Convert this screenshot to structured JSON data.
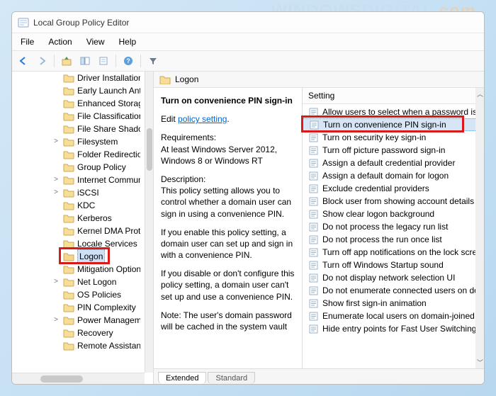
{
  "watermark": "WINDOWSDIGITAL",
  "watermark_suffix": ".com",
  "window": {
    "title": "Local Group Policy Editor"
  },
  "menu": {
    "file": "File",
    "action": "Action",
    "view": "View",
    "help": "Help"
  },
  "tree": {
    "items": [
      {
        "label": "Driver Installation",
        "exp": ""
      },
      {
        "label": "Early Launch Antimalware",
        "exp": ""
      },
      {
        "label": "Enhanced Storage",
        "exp": ""
      },
      {
        "label": "File Classification",
        "exp": ""
      },
      {
        "label": "File Share Shadow Copy",
        "exp": ""
      },
      {
        "label": "Filesystem",
        "exp": ">"
      },
      {
        "label": "Folder Redirection",
        "exp": ""
      },
      {
        "label": "Group Policy",
        "exp": ""
      },
      {
        "label": "Internet Communication",
        "exp": ">"
      },
      {
        "label": "iSCSI",
        "exp": ">"
      },
      {
        "label": "KDC",
        "exp": ""
      },
      {
        "label": "Kerberos",
        "exp": ""
      },
      {
        "label": "Kernel DMA Protection",
        "exp": ""
      },
      {
        "label": "Locale Services",
        "exp": ""
      },
      {
        "label": "Logon",
        "exp": "",
        "selected": true
      },
      {
        "label": "Mitigation Options",
        "exp": ""
      },
      {
        "label": "Net Logon",
        "exp": ">"
      },
      {
        "label": "OS Policies",
        "exp": ""
      },
      {
        "label": "PIN Complexity",
        "exp": ""
      },
      {
        "label": "Power Management",
        "exp": ">"
      },
      {
        "label": "Recovery",
        "exp": ""
      },
      {
        "label": "Remote Assistance",
        "exp": ""
      }
    ]
  },
  "breadcrumb": {
    "label": "Logon"
  },
  "description": {
    "topic": "Turn on convenience PIN sign-in",
    "edit_prefix": "Edit ",
    "edit_link": "policy setting",
    "req_head": "Requirements:",
    "req_body": "At least Windows Server 2012, Windows 8 or Windows RT",
    "desc_head": "Description:",
    "desc_body": "This policy setting allows you to control whether a domain user can sign in using a convenience PIN.",
    "enable_body": "If you enable this policy setting, a domain user can set up and sign in with a convenience PIN.",
    "disable_body": "If you disable or don't configure this policy setting, a domain user can't set up and use a convenience PIN.",
    "note_body": "Note: The user's domain password will be cached in the system vault"
  },
  "settings": {
    "header": "Setting",
    "items": [
      {
        "label": "Allow users to select when a password is required"
      },
      {
        "label": "Turn on convenience PIN sign-in",
        "selected": true
      },
      {
        "label": "Turn on security key sign-in"
      },
      {
        "label": "Turn off picture password sign-in"
      },
      {
        "label": "Assign a default credential provider"
      },
      {
        "label": "Assign a default domain for logon"
      },
      {
        "label": "Exclude credential providers"
      },
      {
        "label": "Block user from showing account details on sign-in"
      },
      {
        "label": "Show clear logon background"
      },
      {
        "label": "Do not process the legacy run list"
      },
      {
        "label": "Do not process the run once list"
      },
      {
        "label": "Turn off app notifications on the lock screen"
      },
      {
        "label": "Turn off Windows Startup sound"
      },
      {
        "label": "Do not display network selection UI"
      },
      {
        "label": "Do not enumerate connected users on domain-joined computers"
      },
      {
        "label": "Show first sign-in animation"
      },
      {
        "label": "Enumerate local users on domain-joined computers"
      },
      {
        "label": "Hide entry points for Fast User Switching"
      }
    ]
  },
  "tabs": {
    "extended": "Extended",
    "standard": "Standard"
  }
}
